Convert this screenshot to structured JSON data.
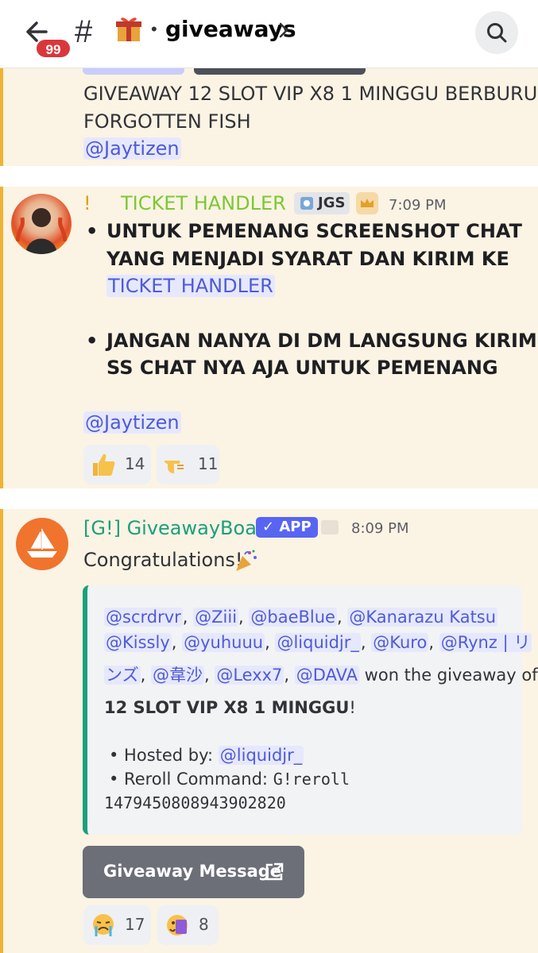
{
  "header": {
    "back_badge": "99",
    "hash": "#",
    "separator": "•",
    "channel_name": "giveaways"
  },
  "prev_message": {
    "text_line1": "GIVEAWAY 12 SLOT VIP X8 1 MINGGU BERBURU",
    "text_line2": "FORGOTTEN FISH",
    "mention": "@Jaytizen"
  },
  "ticket_message": {
    "prefix": "!",
    "author": "TICKET HANDLER",
    "tag": "JGS",
    "time": "7:09 PM",
    "author_color": "#7cc832",
    "bullets": [
      {
        "line1": "UNTUK PEMENANG SCREENSHOT CHAT",
        "line2_pre": "YANG MENJADI SYARAT DAN KIRIM KE ",
        "line2_mention": "@!",
        "line3_mention": "TICKET HANDLER"
      },
      {
        "line1": "JANGAN NANYA DI DM LANGSUNG KIRIM",
        "line2": "SS CHAT NYA AJA UNTUK PEMENANG"
      }
    ],
    "mention": "@Jaytizen",
    "reactions": [
      {
        "emoji": "thumbs-up",
        "count": "14"
      },
      {
        "emoji": "pointing-hand",
        "count": "11"
      }
    ]
  },
  "bot_message": {
    "author": "[G!] GiveawayBoat",
    "author_color": "#1aa07d",
    "app_tag": "✓ APP",
    "time": "8:09 PM",
    "text": "Congratulations!",
    "embed": {
      "winners_line1": [
        "@scrdrvr",
        "@Ziii",
        "@baeBlue",
        "@Kanarazu Katsu"
      ],
      "winners_line2": [
        "@Kissly",
        "@yuhuuu",
        "@liquidjr_",
        "@Kuro",
        "@Rynz | リ"
      ],
      "winners_line3_mentions": [
        "ンズ",
        "@韋沙",
        "@Lexx7",
        "@DAVA"
      ],
      "sep": ", ",
      "won_text": " won the giveaway of",
      "prize": "12 SLOT VIP X8 1 MINGGU",
      "prize_suffix": "!",
      "hosted_label": "• Hosted by: ",
      "hosted_mention": "@liquidjr_",
      "reroll_label": "• Reroll Command: ",
      "reroll_cmd": "G!reroll",
      "reroll_id": "1479450808943902820"
    },
    "button_label": "Giveaway Message",
    "reactions": [
      {
        "emoji": "crying-face",
        "count": "17"
      },
      {
        "emoji": "sticker-face",
        "count": "8"
      }
    ]
  }
}
